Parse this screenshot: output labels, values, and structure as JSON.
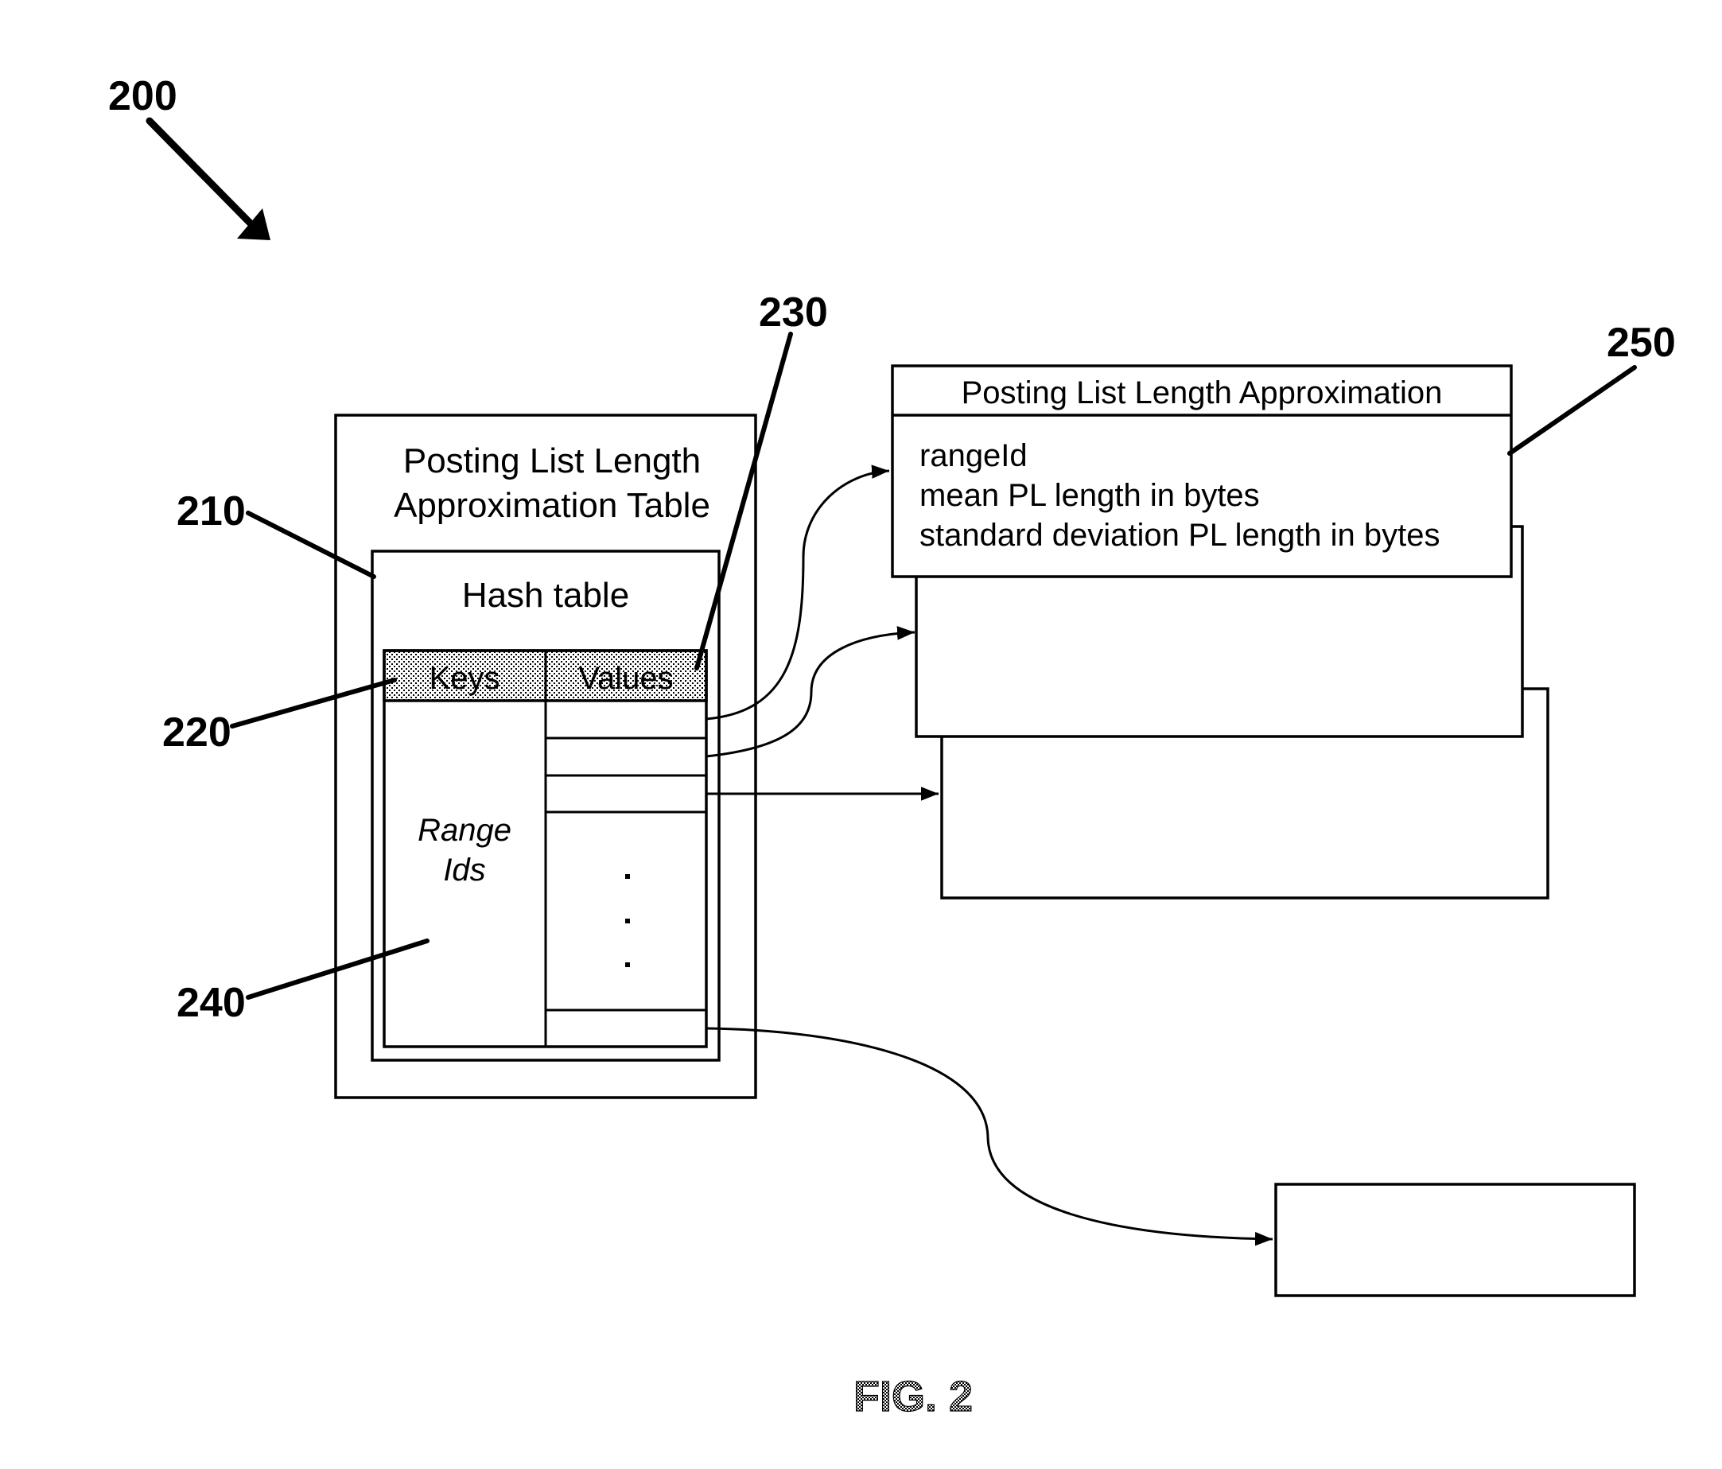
{
  "figure": {
    "caption": "FIG. 2",
    "reference_numbers": {
      "overall": "200",
      "hash_table": "210",
      "keys": "220",
      "values": "230",
      "range_ids": "240",
      "approximation_record": "250"
    }
  },
  "table_container": {
    "title_line1": "Posting List Length",
    "title_line2": "Approximation Table",
    "hash_table": {
      "title": "Hash table",
      "columns": [
        "Keys",
        "Values"
      ],
      "keys_label_line1": "Range",
      "keys_label_line2": "Ids",
      "ellipsis": "· · ·"
    }
  },
  "record": {
    "title": "Posting List Length Approximation",
    "fields": [
      "rangeId",
      "mean PL length in bytes",
      "standard deviation PL length in bytes"
    ]
  },
  "colors": {
    "stroke": "#000000",
    "background": "#ffffff",
    "header_fill": "#d0d0d0"
  }
}
